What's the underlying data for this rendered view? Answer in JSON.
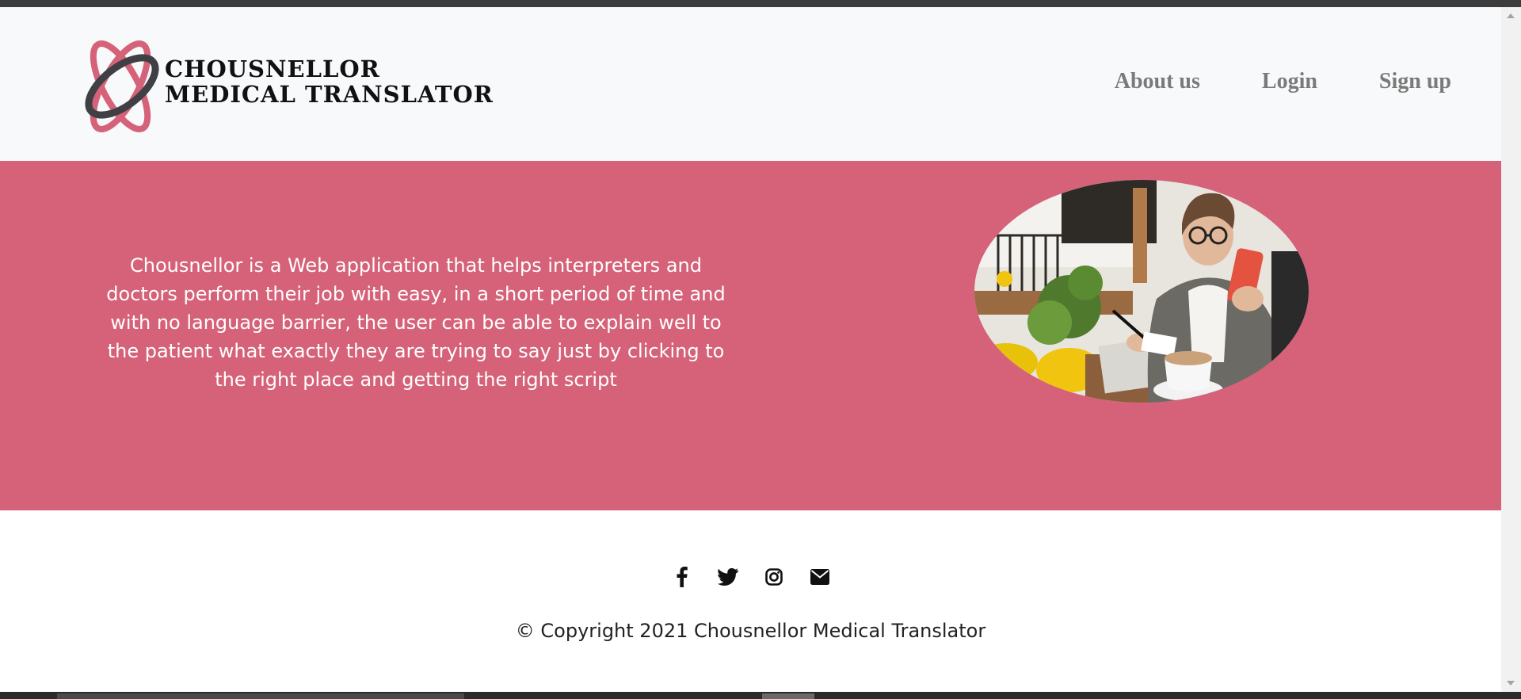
{
  "brand": {
    "line1": "CHOUSNELLOR",
    "line2": "MEDICAL TRANSLATOR",
    "colors": {
      "pink": "#d56278",
      "dark": "#3f4046"
    }
  },
  "nav": {
    "items": [
      {
        "label": "About us"
      },
      {
        "label": "Login"
      },
      {
        "label": "Sign up"
      }
    ]
  },
  "hero": {
    "description": "Chousnellor is a Web application that helps interpreters and doctors perform their job with easy, in a short period of time and with no language barrier, the user can be able to explain well to the patient what exactly they are trying to say just by clicking to the right place and getting the right script",
    "background": "#d56278"
  },
  "footer": {
    "social": [
      {
        "icon": "facebook-icon"
      },
      {
        "icon": "twitter-icon"
      },
      {
        "icon": "instagram-icon"
      },
      {
        "icon": "envelope-icon"
      }
    ],
    "copyright": "© Copyright 2021 Chousnellor Medical Translator"
  }
}
